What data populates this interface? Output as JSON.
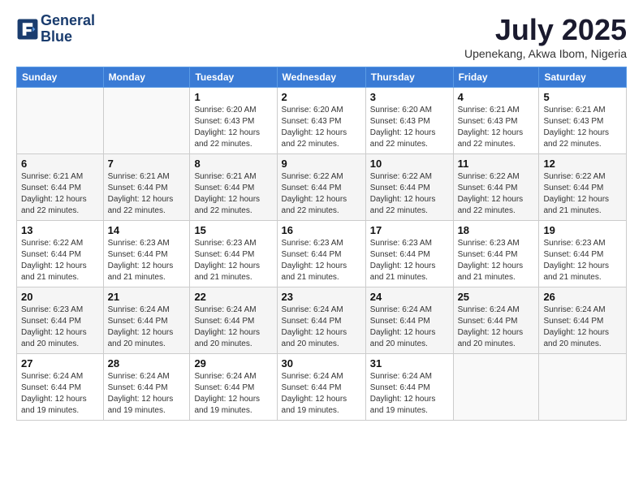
{
  "logo": {
    "line1": "General",
    "line2": "Blue"
  },
  "header": {
    "month": "July 2025",
    "location": "Upenekang, Akwa Ibom, Nigeria"
  },
  "weekdays": [
    "Sunday",
    "Monday",
    "Tuesday",
    "Wednesday",
    "Thursday",
    "Friday",
    "Saturday"
  ],
  "weeks": [
    [
      {
        "day": "",
        "sunrise": "",
        "sunset": "",
        "daylight": ""
      },
      {
        "day": "",
        "sunrise": "",
        "sunset": "",
        "daylight": ""
      },
      {
        "day": "1",
        "sunrise": "Sunrise: 6:20 AM",
        "sunset": "Sunset: 6:43 PM",
        "daylight": "Daylight: 12 hours and 22 minutes."
      },
      {
        "day": "2",
        "sunrise": "Sunrise: 6:20 AM",
        "sunset": "Sunset: 6:43 PM",
        "daylight": "Daylight: 12 hours and 22 minutes."
      },
      {
        "day": "3",
        "sunrise": "Sunrise: 6:20 AM",
        "sunset": "Sunset: 6:43 PM",
        "daylight": "Daylight: 12 hours and 22 minutes."
      },
      {
        "day": "4",
        "sunrise": "Sunrise: 6:21 AM",
        "sunset": "Sunset: 6:43 PM",
        "daylight": "Daylight: 12 hours and 22 minutes."
      },
      {
        "day": "5",
        "sunrise": "Sunrise: 6:21 AM",
        "sunset": "Sunset: 6:43 PM",
        "daylight": "Daylight: 12 hours and 22 minutes."
      }
    ],
    [
      {
        "day": "6",
        "sunrise": "Sunrise: 6:21 AM",
        "sunset": "Sunset: 6:44 PM",
        "daylight": "Daylight: 12 hours and 22 minutes."
      },
      {
        "day": "7",
        "sunrise": "Sunrise: 6:21 AM",
        "sunset": "Sunset: 6:44 PM",
        "daylight": "Daylight: 12 hours and 22 minutes."
      },
      {
        "day": "8",
        "sunrise": "Sunrise: 6:21 AM",
        "sunset": "Sunset: 6:44 PM",
        "daylight": "Daylight: 12 hours and 22 minutes."
      },
      {
        "day": "9",
        "sunrise": "Sunrise: 6:22 AM",
        "sunset": "Sunset: 6:44 PM",
        "daylight": "Daylight: 12 hours and 22 minutes."
      },
      {
        "day": "10",
        "sunrise": "Sunrise: 6:22 AM",
        "sunset": "Sunset: 6:44 PM",
        "daylight": "Daylight: 12 hours and 22 minutes."
      },
      {
        "day": "11",
        "sunrise": "Sunrise: 6:22 AM",
        "sunset": "Sunset: 6:44 PM",
        "daylight": "Daylight: 12 hours and 22 minutes."
      },
      {
        "day": "12",
        "sunrise": "Sunrise: 6:22 AM",
        "sunset": "Sunset: 6:44 PM",
        "daylight": "Daylight: 12 hours and 21 minutes."
      }
    ],
    [
      {
        "day": "13",
        "sunrise": "Sunrise: 6:22 AM",
        "sunset": "Sunset: 6:44 PM",
        "daylight": "Daylight: 12 hours and 21 minutes."
      },
      {
        "day": "14",
        "sunrise": "Sunrise: 6:23 AM",
        "sunset": "Sunset: 6:44 PM",
        "daylight": "Daylight: 12 hours and 21 minutes."
      },
      {
        "day": "15",
        "sunrise": "Sunrise: 6:23 AM",
        "sunset": "Sunset: 6:44 PM",
        "daylight": "Daylight: 12 hours and 21 minutes."
      },
      {
        "day": "16",
        "sunrise": "Sunrise: 6:23 AM",
        "sunset": "Sunset: 6:44 PM",
        "daylight": "Daylight: 12 hours and 21 minutes."
      },
      {
        "day": "17",
        "sunrise": "Sunrise: 6:23 AM",
        "sunset": "Sunset: 6:44 PM",
        "daylight": "Daylight: 12 hours and 21 minutes."
      },
      {
        "day": "18",
        "sunrise": "Sunrise: 6:23 AM",
        "sunset": "Sunset: 6:44 PM",
        "daylight": "Daylight: 12 hours and 21 minutes."
      },
      {
        "day": "19",
        "sunrise": "Sunrise: 6:23 AM",
        "sunset": "Sunset: 6:44 PM",
        "daylight": "Daylight: 12 hours and 21 minutes."
      }
    ],
    [
      {
        "day": "20",
        "sunrise": "Sunrise: 6:23 AM",
        "sunset": "Sunset: 6:44 PM",
        "daylight": "Daylight: 12 hours and 20 minutes."
      },
      {
        "day": "21",
        "sunrise": "Sunrise: 6:24 AM",
        "sunset": "Sunset: 6:44 PM",
        "daylight": "Daylight: 12 hours and 20 minutes."
      },
      {
        "day": "22",
        "sunrise": "Sunrise: 6:24 AM",
        "sunset": "Sunset: 6:44 PM",
        "daylight": "Daylight: 12 hours and 20 minutes."
      },
      {
        "day": "23",
        "sunrise": "Sunrise: 6:24 AM",
        "sunset": "Sunset: 6:44 PM",
        "daylight": "Daylight: 12 hours and 20 minutes."
      },
      {
        "day": "24",
        "sunrise": "Sunrise: 6:24 AM",
        "sunset": "Sunset: 6:44 PM",
        "daylight": "Daylight: 12 hours and 20 minutes."
      },
      {
        "day": "25",
        "sunrise": "Sunrise: 6:24 AM",
        "sunset": "Sunset: 6:44 PM",
        "daylight": "Daylight: 12 hours and 20 minutes."
      },
      {
        "day": "26",
        "sunrise": "Sunrise: 6:24 AM",
        "sunset": "Sunset: 6:44 PM",
        "daylight": "Daylight: 12 hours and 20 minutes."
      }
    ],
    [
      {
        "day": "27",
        "sunrise": "Sunrise: 6:24 AM",
        "sunset": "Sunset: 6:44 PM",
        "daylight": "Daylight: 12 hours and 19 minutes."
      },
      {
        "day": "28",
        "sunrise": "Sunrise: 6:24 AM",
        "sunset": "Sunset: 6:44 PM",
        "daylight": "Daylight: 12 hours and 19 minutes."
      },
      {
        "day": "29",
        "sunrise": "Sunrise: 6:24 AM",
        "sunset": "Sunset: 6:44 PM",
        "daylight": "Daylight: 12 hours and 19 minutes."
      },
      {
        "day": "30",
        "sunrise": "Sunrise: 6:24 AM",
        "sunset": "Sunset: 6:44 PM",
        "daylight": "Daylight: 12 hours and 19 minutes."
      },
      {
        "day": "31",
        "sunrise": "Sunrise: 6:24 AM",
        "sunset": "Sunset: 6:44 PM",
        "daylight": "Daylight: 12 hours and 19 minutes."
      },
      {
        "day": "",
        "sunrise": "",
        "sunset": "",
        "daylight": ""
      },
      {
        "day": "",
        "sunrise": "",
        "sunset": "",
        "daylight": ""
      }
    ]
  ]
}
